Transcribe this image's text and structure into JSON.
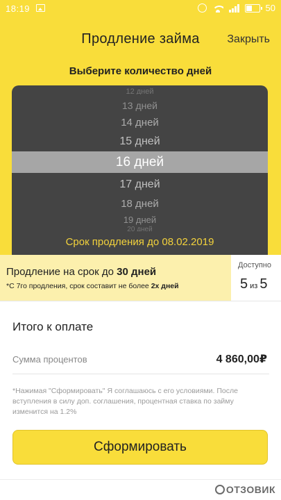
{
  "status_bar": {
    "time": "18:19",
    "battery": "50"
  },
  "header": {
    "title": "Продление займа",
    "close_label": "Закрыть"
  },
  "days_picker": {
    "prompt": "Выберите количество дней",
    "options": [
      "12 дней",
      "13 дней",
      "14 дней",
      "15 дней",
      "16 дней",
      "17 дней",
      "18 дней",
      "19 дней",
      "20 дней"
    ],
    "selected": "16 дней",
    "period_text": "Срок продления до 08.02.2019"
  },
  "extension": {
    "title_prefix": "Продление на срок до",
    "title_value": "30 дней",
    "note_prefix": "*С 7го продления, срок составит не более",
    "note_value": "2х дней"
  },
  "available": {
    "label": "Доступно",
    "current": "5",
    "of": "из",
    "total": "5"
  },
  "payment": {
    "title": "Итого к оплате",
    "interest_label": "Сумма процентов",
    "interest_value": "4 860,00₽",
    "legal_text": "*Нажимая \"Сформировать\" Я соглашаюсь с его условиями. После вступления в силу доп. соглашения, процентная ставка по займу изменится на 1.2%",
    "submit_label": "Сформировать"
  },
  "watermark": "ОТЗОВИК",
  "colors": {
    "accent_yellow": "#f9dd3a",
    "picker_bg": "#444444",
    "picker_selected": "#a6a6a6",
    "period_text": "#f3d23c",
    "banner_bg": "#fcf0ad"
  }
}
